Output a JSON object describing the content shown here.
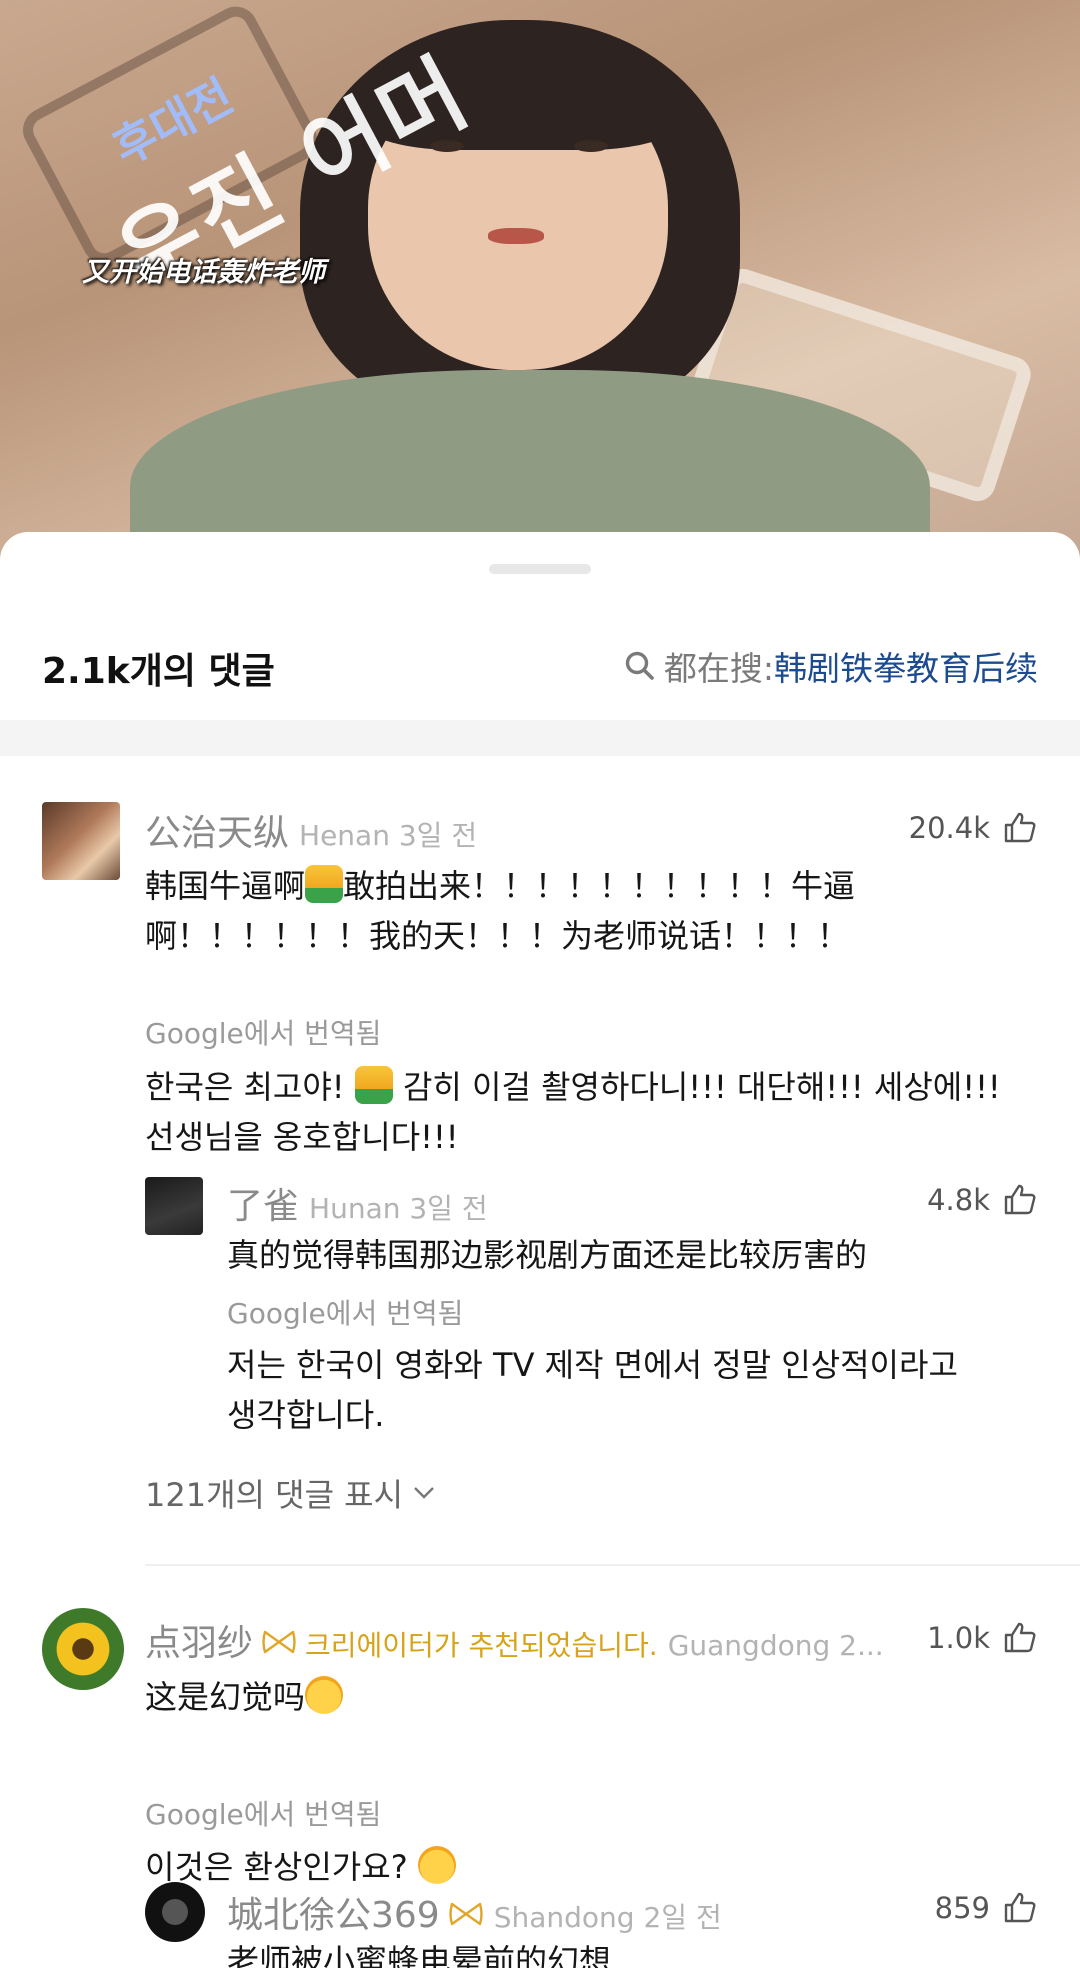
{
  "video": {
    "overlay_korean": "우진 어머",
    "overlay_korean_small": "후대전",
    "caption": "又开始电话轰炸老师"
  },
  "header": {
    "comment_count": "2.1k개의 댓글",
    "search_prefix": "都在搜: ",
    "search_topic": "韩剧铁拳教育后续"
  },
  "comments": [
    {
      "username": "公治天纵",
      "location_time": "Henan 3일 전",
      "likes": "20.4k",
      "text_part1": "韩国牛逼啊",
      "text_part2": "敢拍出来！！！！！！！！！！牛逼",
      "text_line2": "啊！！！！！！我的天！！！为老师说话！！！！",
      "translated_label": "Google에서 번역됨",
      "translation_part1": "한국은 최고야! ",
      "translation_part2": " 감히 이걸 촬영하다니!!! 대단해!!! 세상에!!!",
      "translation_line2": "선생님을 옹호합니다!!!",
      "reply": {
        "username": "了雀",
        "location_time": "Hunan 3일 전",
        "likes": "4.8k",
        "text": "真的觉得韩国那边影视剧方面还是比较厉害的",
        "translated_label": "Google에서 번역됨",
        "translation_line1": "저는 한국이 영화와 TV 제작 면에서 정말 인상적이라고",
        "translation_line2": "생각합니다."
      },
      "show_replies": "121개의 댓글 표시"
    },
    {
      "username": "点羽纱",
      "badge": "크리에이터가 추천되었습니다.",
      "location_time": "Guangdong 2...",
      "likes": "1.0k",
      "text": "这是幻觉吗",
      "translated_label": "Google에서 번역됨",
      "translation": "이것은 환상인가요? ",
      "reply": {
        "username": "城北徐公369",
        "location_time": "Shandong 2일 전",
        "likes": "859",
        "text": "老师被小蜜蜂电晕前的幻想"
      }
    }
  ],
  "icons": {
    "like": "thumb-up-outline-icon",
    "search": "magnifier-icon",
    "creator_badge": "bow-icon",
    "expand": "chevron-down-icon"
  },
  "colors": {
    "link_blue": "#1d4b8f",
    "badge_gold": "#d6a319",
    "meta_gray": "#8a8a8a"
  }
}
